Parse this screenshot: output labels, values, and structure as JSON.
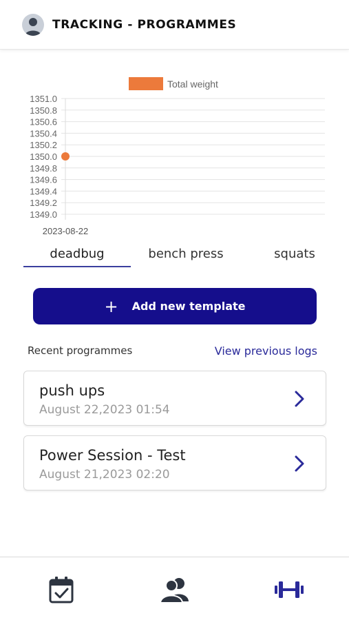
{
  "header": {
    "title": "TRACKING - PROGRAMMES",
    "avatar_icon": "user-avatar-icon"
  },
  "chart_data": {
    "type": "line",
    "x": [
      "2023-08-22"
    ],
    "series": [
      {
        "name": "Total weight",
        "values": [
          1350.0
        ],
        "color": "#ec7a3b"
      }
    ],
    "y_ticks": [
      "1351.0",
      "1350.8",
      "1350.6",
      "1350.4",
      "1350.2",
      "1350.0",
      "1349.8",
      "1349.6",
      "1349.4",
      "1349.2",
      "1349.0"
    ],
    "ylim": [
      1349.0,
      1351.0
    ],
    "legend": "top",
    "grid": true
  },
  "tabs": [
    {
      "label": "deadbug",
      "active": true
    },
    {
      "label": "bench press",
      "active": false
    },
    {
      "label": "squats",
      "active": false
    }
  ],
  "add_template": {
    "icon": "plus-icon",
    "label": "Add new template"
  },
  "recent": {
    "label": "Recent programmes",
    "view_previous": "View previous logs",
    "items": [
      {
        "title": "push ups",
        "date": "August 22,2023 01:54"
      },
      {
        "title": "Power Session - Test",
        "date": "August 21,2023 02:20"
      }
    ]
  },
  "bottom_nav": {
    "items": [
      {
        "icon": "calendar-check-icon"
      },
      {
        "icon": "users-icon"
      },
      {
        "icon": "dumbbell-icon"
      }
    ],
    "active_color": "#2a2a9a"
  }
}
